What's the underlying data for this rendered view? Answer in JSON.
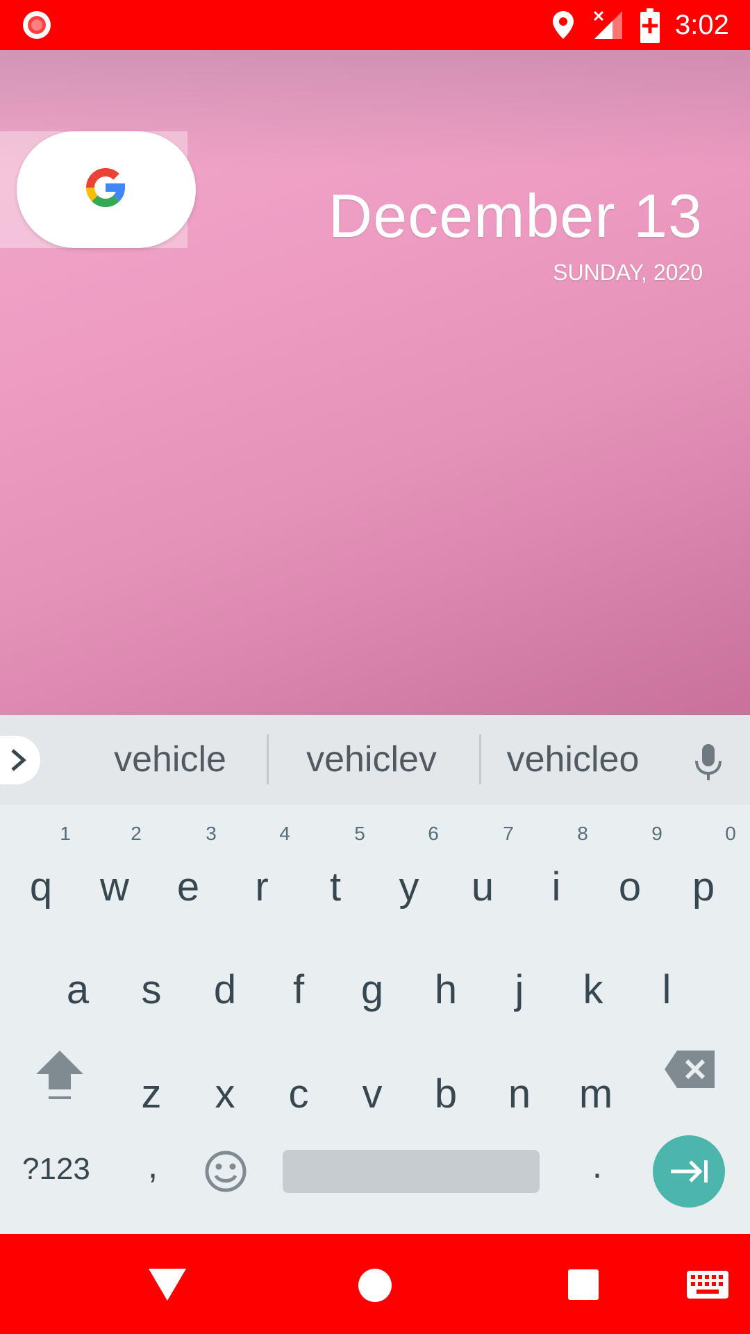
{
  "status_bar": {
    "time": "3:02",
    "icons": [
      "screen-record-icon",
      "location-icon",
      "signal-no-data-icon",
      "battery-charging-icon"
    ],
    "background": "#ff0000"
  },
  "home": {
    "search_widget": "google-search-pill",
    "date_title": "December 13",
    "date_subtitle": "SUNDAY, 2020"
  },
  "keyboard": {
    "suggestions": [
      "vehicle",
      "vehiclev",
      "vehicleo"
    ],
    "row1": [
      {
        "key": "q",
        "hint": "1"
      },
      {
        "key": "w",
        "hint": "2"
      },
      {
        "key": "e",
        "hint": "3"
      },
      {
        "key": "r",
        "hint": "4"
      },
      {
        "key": "t",
        "hint": "5"
      },
      {
        "key": "y",
        "hint": "6"
      },
      {
        "key": "u",
        "hint": "7"
      },
      {
        "key": "i",
        "hint": "8"
      },
      {
        "key": "o",
        "hint": "9"
      },
      {
        "key": "p",
        "hint": "0"
      }
    ],
    "row2": [
      "a",
      "s",
      "d",
      "f",
      "g",
      "h",
      "j",
      "k",
      "l"
    ],
    "row3": [
      "z",
      "x",
      "c",
      "v",
      "b",
      "n",
      "m"
    ],
    "symbols_label": "?123",
    "comma": ",",
    "period": ".",
    "accent": "#4db6ac"
  },
  "nav_bar": {
    "icons": [
      "back-icon",
      "home-icon",
      "recents-icon",
      "keyboard-switch-icon"
    ],
    "background": "#ff0000"
  }
}
